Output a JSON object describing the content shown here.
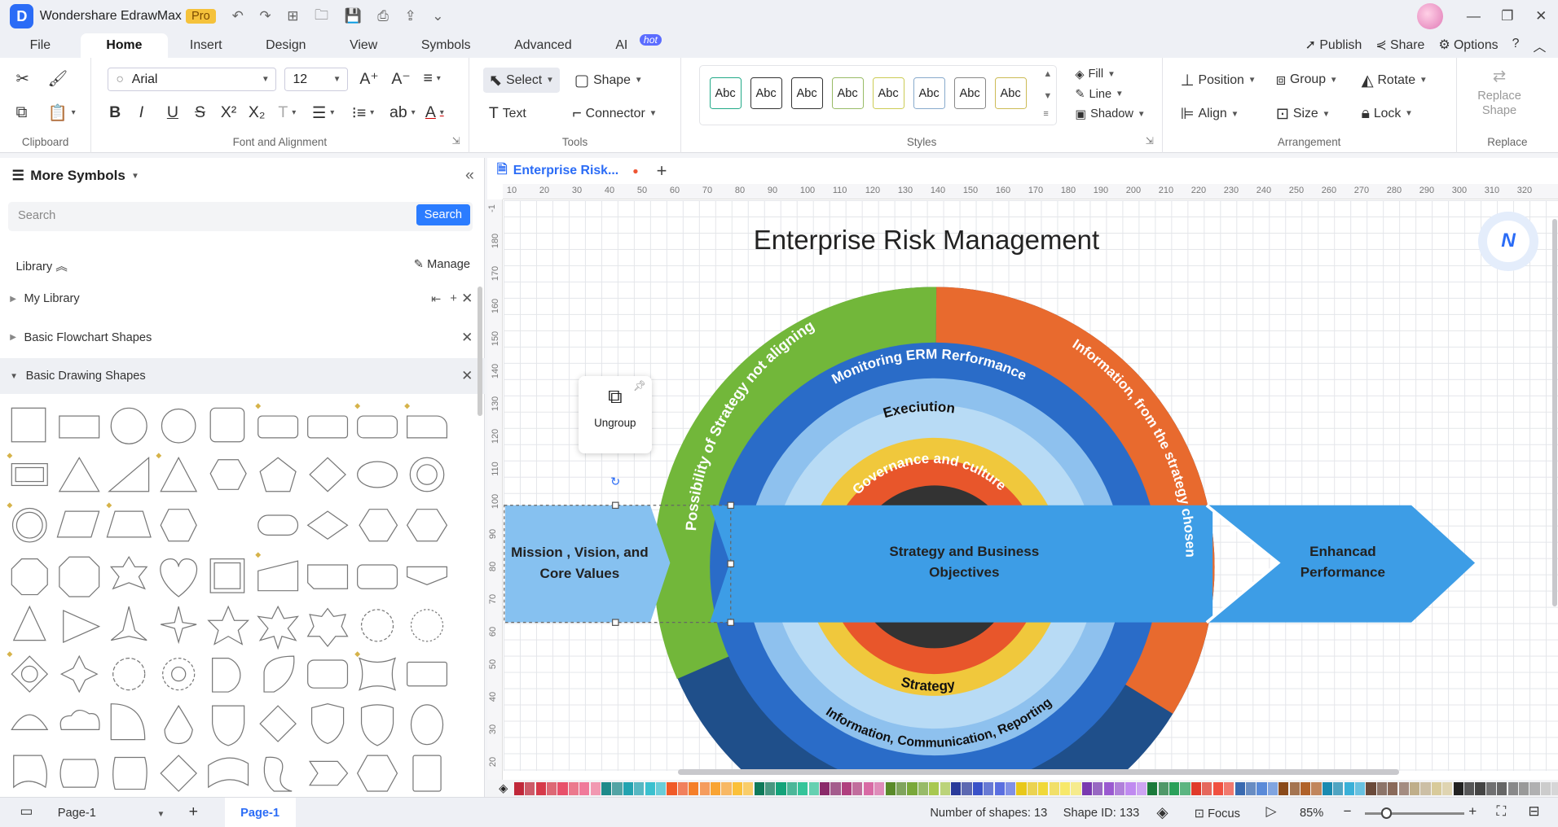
{
  "app": {
    "name": "Wondershare EdrawMax",
    "badge": "Pro"
  },
  "menu": {
    "items": [
      "File",
      "Home",
      "Insert",
      "Design",
      "View",
      "Symbols",
      "Advanced",
      "AI"
    ],
    "active": "Home",
    "ai_badge": "hot",
    "right": {
      "publish": "Publish",
      "share": "Share",
      "options": "Options"
    }
  },
  "ribbon": {
    "clipboard": {
      "label": "Clipboard"
    },
    "font": {
      "label": "Font and Alignment",
      "family": "Arial",
      "size": "12"
    },
    "tools": {
      "label": "Tools",
      "select": "Select",
      "shape": "Shape",
      "text": "Text",
      "connector": "Connector"
    },
    "styles": {
      "label": "Styles",
      "swatches": [
        "Abc",
        "Abc",
        "Abc",
        "Abc",
        "Abc",
        "Abc",
        "Abc",
        "Abc"
      ],
      "fill": "Fill",
      "line": "Line",
      "shadow": "Shadow"
    },
    "arrangement": {
      "label": "Arrangement",
      "position": "Position",
      "group": "Group",
      "rotate": "Rotate",
      "align": "Align",
      "size": "Size",
      "lock": "Lock"
    },
    "replace": {
      "label": "Replace",
      "btn": "Replace Shape"
    }
  },
  "sidebar": {
    "title": "More Symbols",
    "search_placeholder": "Search",
    "search_btn": "Search",
    "library": "Library",
    "manage": "Manage",
    "libs": [
      "My Library",
      "Basic Flowchart Shapes",
      "Basic Drawing Shapes"
    ]
  },
  "doc": {
    "tab": "Enterprise Risk...",
    "popup_label": "Ungroup"
  },
  "ruler": {
    "h": [
      "10",
      "20",
      "30",
      "40",
      "50",
      "60",
      "70",
      "80",
      "90",
      "100",
      "110",
      "120",
      "130",
      "140",
      "150",
      "160",
      "170",
      "180",
      "190",
      "200",
      "210",
      "220",
      "230",
      "240",
      "250",
      "260",
      "270",
      "280",
      "290",
      "300",
      "310",
      "320"
    ],
    "v": [
      "-1",
      "180",
      "170",
      "160",
      "150",
      "140",
      "130",
      "120",
      "110",
      "100",
      "90",
      "80",
      "70",
      "60",
      "50",
      "40",
      "30",
      "20"
    ]
  },
  "diagram": {
    "title": "Enterprise Risk Management",
    "outer_left": "Possibility of Strategy not aligning",
    "outer_right": "Information, from the strategy chosen",
    "ring2_top": "Monitoring ERM Rerformance",
    "ring2_bottom": "Information, Communication, Reporting",
    "ring3_top": "Execiution",
    "ring3_bottom": "Strategy",
    "ring4_top": "Governance and culture",
    "left_arrow": [
      "Mission , Vision, and",
      "Core Values"
    ],
    "band": [
      "Strategy and Business",
      "Objectives"
    ],
    "right_arrow": [
      "Enhancad",
      "Performance"
    ],
    "colors": {
      "green": "#72b73a",
      "orange": "#e86a2e",
      "dark": "#1f4f8a",
      "blue1": "#2a6cc8",
      "blue2": "#8ec1ee",
      "blue3": "#b8dbf5",
      "yellow": "#f0c83c",
      "red": "#e8562b",
      "core": "#333333",
      "band": "#3d9de6",
      "left": "#86c1f0"
    }
  },
  "status": {
    "page_selector": "Page-1",
    "page_tab": "Page-1",
    "shapes": "Number of shapes: 13",
    "shape_id": "Shape ID: 133",
    "focus": "Focus",
    "zoom": "85%"
  },
  "palette_colors": [
    "#c0283a",
    "#d63a4a",
    "#e8506a",
    "#f07a9a",
    "#1e8a8a",
    "#23a3b0",
    "#3bc0cf",
    "#f05a28",
    "#f57f2a",
    "#f9a433",
    "#fbc03a",
    "#0f7a5a",
    "#14a37a",
    "#35c49a",
    "#8a2a6a",
    "#b0407f",
    "#d86aa5",
    "#5a8a2a",
    "#7aa83a",
    "#a8c850",
    "#2a3a9a",
    "#3a52c8",
    "#5a6fe0",
    "#e8c81a",
    "#f0d83a",
    "#f7e86a",
    "#7a3ab0",
    "#9a5ad0",
    "#c08af0",
    "#1a7a3a",
    "#2aa05a",
    "#e03a2a",
    "#f05040",
    "#3a6ab0",
    "#5a8ad8",
    "#8a4a1a",
    "#b0622a",
    "#1a8ab0",
    "#3ab0d8",
    "#6a4a3a",
    "#8a6a5a",
    "#bfae8a",
    "#d8ca9a",
    "#222222",
    "#444444",
    "#666666",
    "#999999",
    "#cccccc"
  ]
}
